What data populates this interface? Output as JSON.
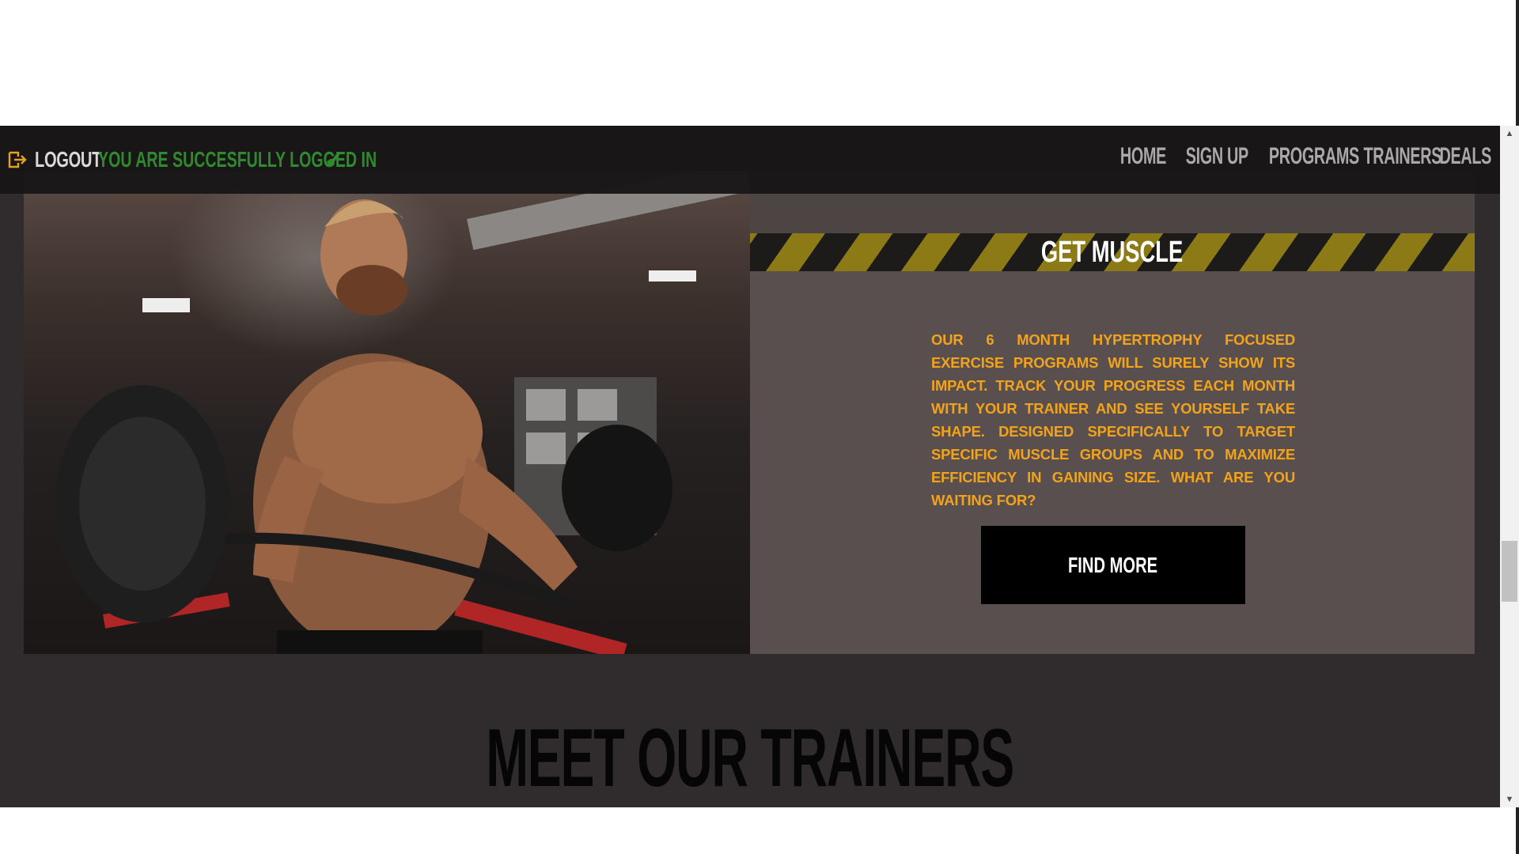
{
  "header": {
    "logout_label": "LOGOUT",
    "login_status": "YOU ARE SUCCESFULLY LOGGED IN",
    "login_check": "✓"
  },
  "nav": {
    "items": [
      "HOME",
      "SIGN UP",
      "PROGRAMS",
      "TRAINERS",
      "DEALS"
    ]
  },
  "program": {
    "title": "GET MUSCLE",
    "description": "OUR 6 MONTH HYPERTROPHY FOCUSED EXERCISE PROGRAMS WILL SURELY SHOW ITS IMPACT. TRACK YOUR PROGRESS EACH MONTH WITH YOUR TRAINER AND SEE YOURSELF TAKE SHAPE. DESIGNED SPECIFICALLY TO TARGET SPECIFIC MUSCLE GROUPS AND TO MAXIMIZE EFFICIENCY IN GAINING SIZE. WHAT ARE YOU WAITING FOR?",
    "button_label": "FIND MORE",
    "image_icon": "bodybuilder-photo"
  },
  "trainers_section": {
    "heading": "MEET OUR TRAINERS"
  },
  "colors": {
    "background": "#302c2d",
    "nav_bar": "#181617",
    "nav_text": "#a9a9a9",
    "status_green": "#2f8a2d",
    "accent_orange": "#f2a31c",
    "hazard_yellow": "#8c7a16",
    "panel": "#5a4f4f",
    "button": "#000000"
  }
}
